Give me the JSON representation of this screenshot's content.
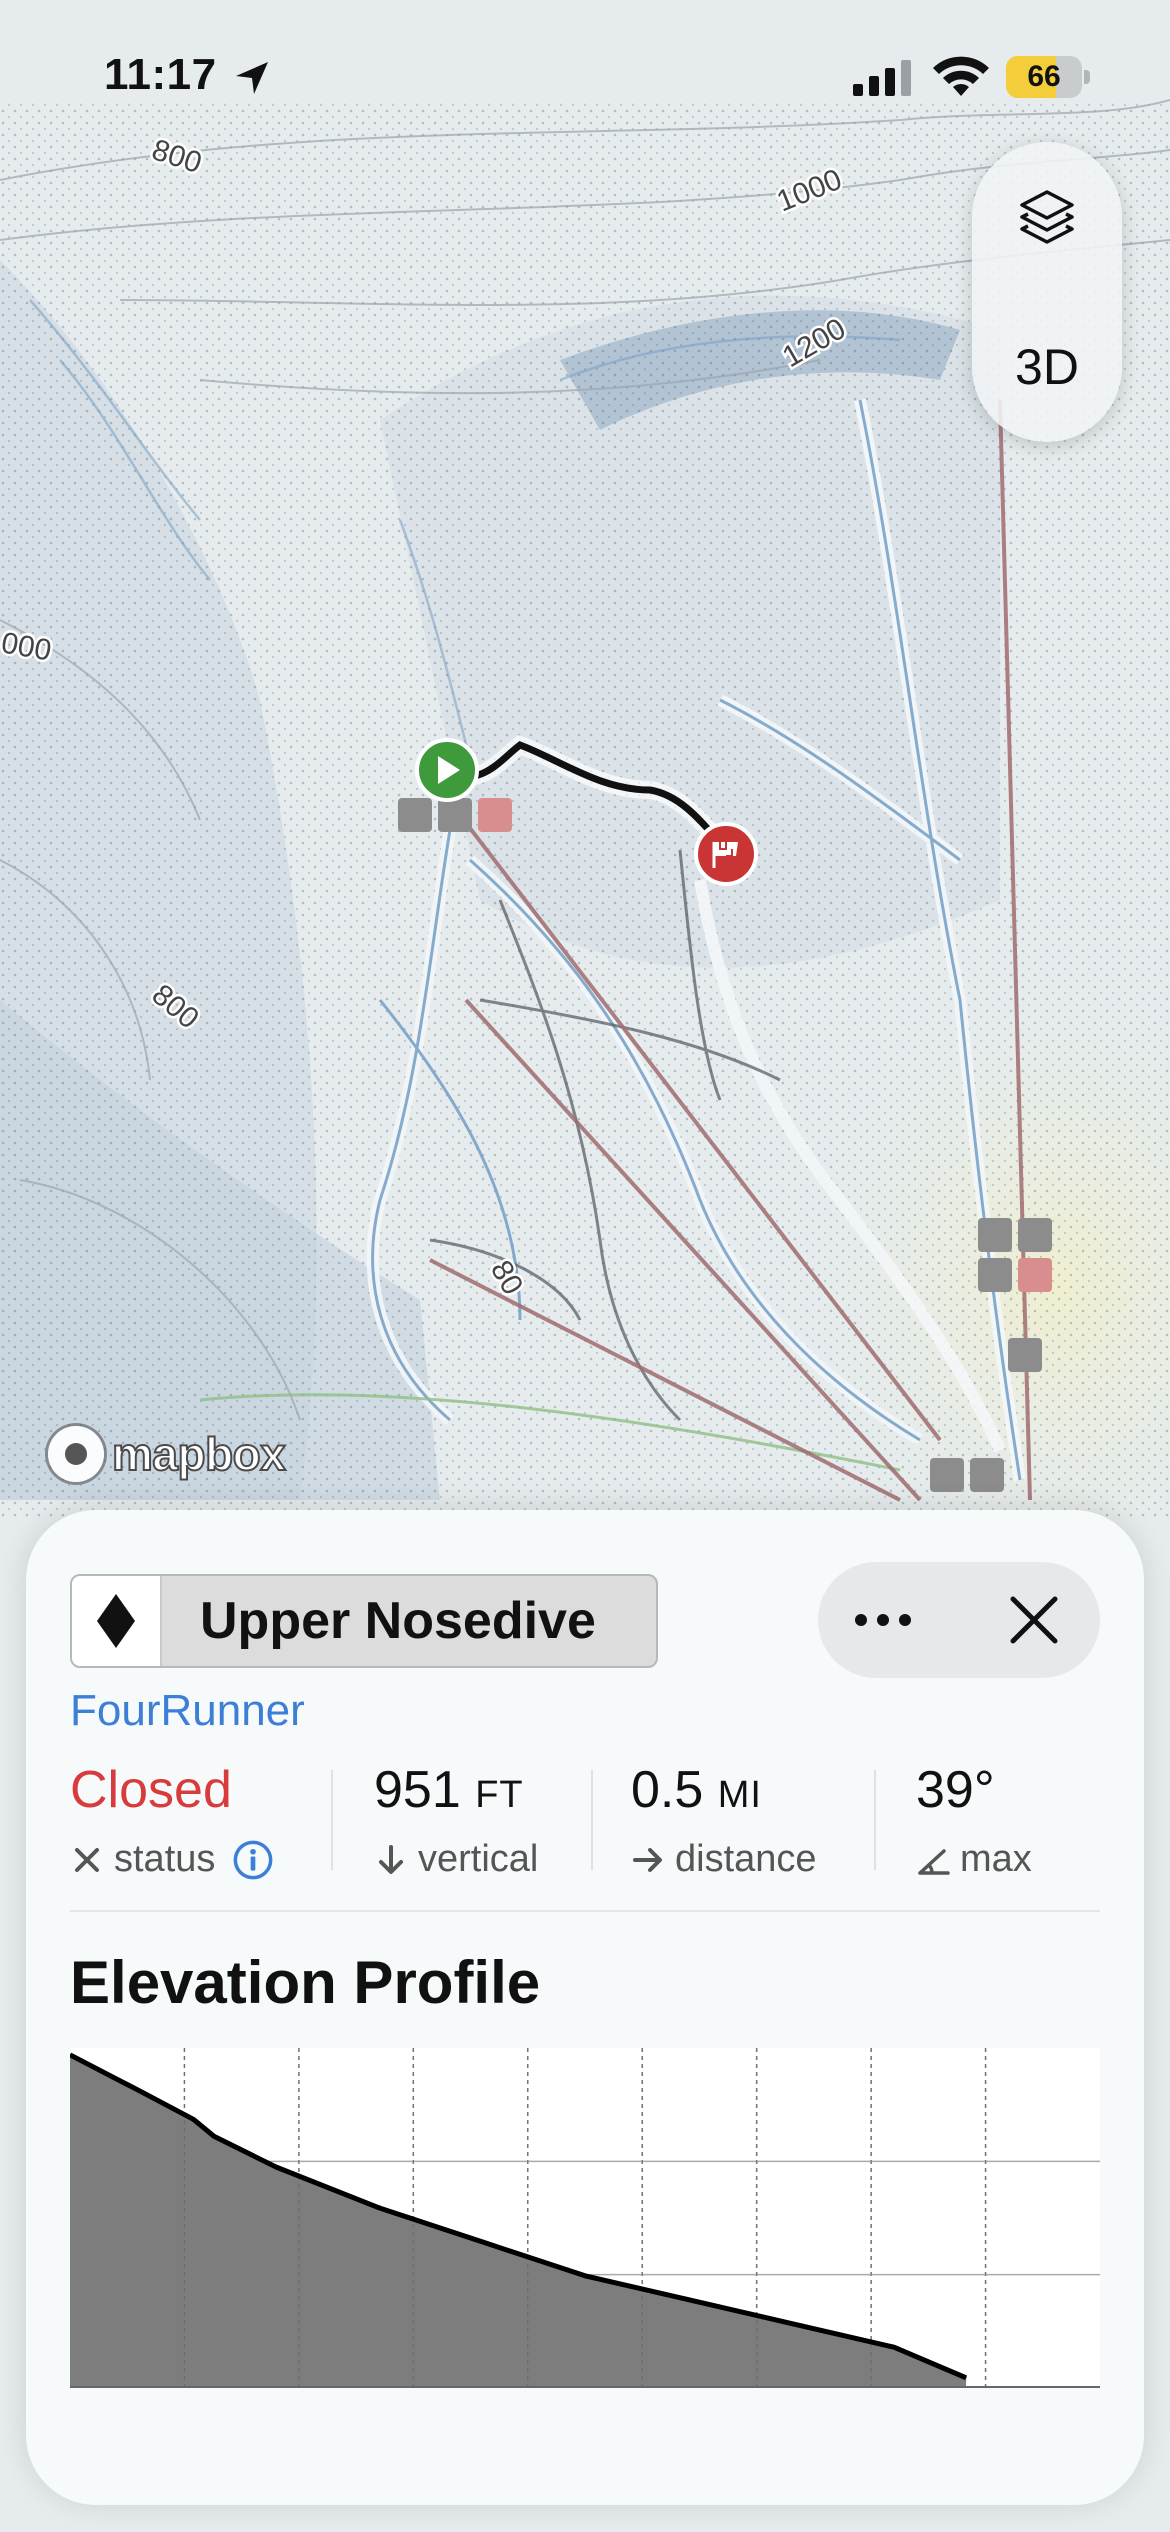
{
  "status_bar": {
    "time": "11:17",
    "battery": "66",
    "battery_percent": 66
  },
  "map": {
    "contour_labels": [
      "800",
      "1000",
      "1200",
      "000",
      "800",
      "80"
    ],
    "logo_text": "mapbox"
  },
  "map_controls": {
    "layers_icon": "layers-icon",
    "three_d_label": "3D"
  },
  "panel": {
    "difficulty_icon": "black-diamond-icon",
    "run_name": "Upper Nosedive",
    "lift_name": "FourRunner",
    "stats": [
      {
        "value": "Closed",
        "unit": "",
        "label": "status",
        "icon": "x-icon"
      },
      {
        "value": "951",
        "unit": "FT",
        "label": "vertical",
        "icon": "arrow-down-icon"
      },
      {
        "value": "0.5",
        "unit": "MI",
        "label": "distance",
        "icon": "arrow-right-icon"
      },
      {
        "value": "39°",
        "unit": "",
        "label": "max",
        "icon": "angle-icon"
      }
    ],
    "elevation_title": "Elevation Profile"
  },
  "colors": {
    "accent": "#3d7fd6",
    "closed": "#d83b3b",
    "start": "#3f9a3b",
    "finish": "#c93434"
  },
  "chart_data": {
    "type": "area",
    "title": "Elevation Profile",
    "xlabel": "",
    "ylabel": "",
    "x": [
      0,
      0.07,
      0.12,
      0.14,
      0.2,
      0.3,
      0.4,
      0.5,
      0.6,
      0.7,
      0.8,
      0.87
    ],
    "values": [
      0.98,
      0.87,
      0.79,
      0.74,
      0.65,
      0.53,
      0.43,
      0.33,
      0.26,
      0.19,
      0.12,
      0.03
    ],
    "xlim": [
      0,
      1
    ],
    "ylim": [
      0,
      1
    ],
    "grid": true,
    "legend": "none"
  }
}
